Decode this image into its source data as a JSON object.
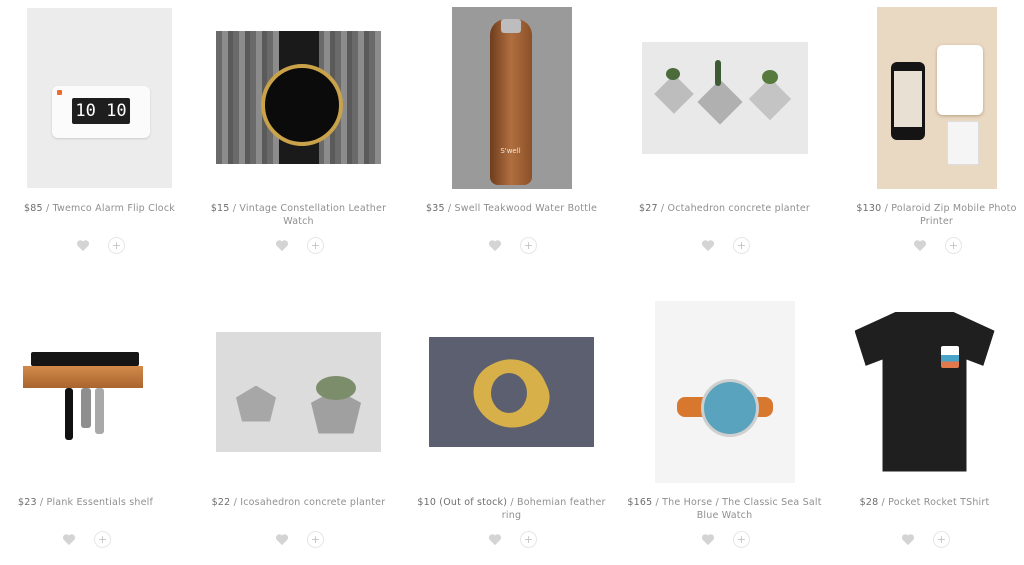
{
  "products": [
    {
      "price": "$85",
      "name": "Twemco Alarm Flip Clock",
      "image": "alarm-clock-photo"
    },
    {
      "price": "$15",
      "name": "Vintage Constellation Leather Watch",
      "image": "constellation-watch-photo"
    },
    {
      "price": "$35",
      "name": "Swell Teakwood Water Bottle",
      "image": "water-bottle-photo"
    },
    {
      "price": "$27",
      "name": "Octahedron concrete planter",
      "image": "octahedron-planter-photo"
    },
    {
      "price": "$130",
      "name": "Polaroid Zip Mobile Photo Printer",
      "image": "photo-printer-photo"
    },
    {
      "price": "$23",
      "name": "Plank Essentials shelf",
      "image": "plank-shelf-photo"
    },
    {
      "price": "$22",
      "name": "Icosahedron concrete planter",
      "image": "icosahedron-planter-photo"
    },
    {
      "price": "$10 (Out of stock)",
      "name": "Bohemian feather ring",
      "image": "feather-ring-photo"
    },
    {
      "price": "$165",
      "name": "The Horse / The Classic Sea Salt Blue Watch",
      "image": "blue-watch-photo"
    },
    {
      "price": "$28",
      "name": "Pocket Rocket TShirt",
      "image": "tshirt-photo"
    }
  ],
  "clock_display": "10 10",
  "bottle_brand": "S'well",
  "separator": " / ",
  "add_symbol": "+",
  "icons": {
    "like": "heart-icon",
    "add": "plus-icon"
  },
  "colors": {
    "caption": "#8f8f8f",
    "icon": "#d0d0d0"
  }
}
